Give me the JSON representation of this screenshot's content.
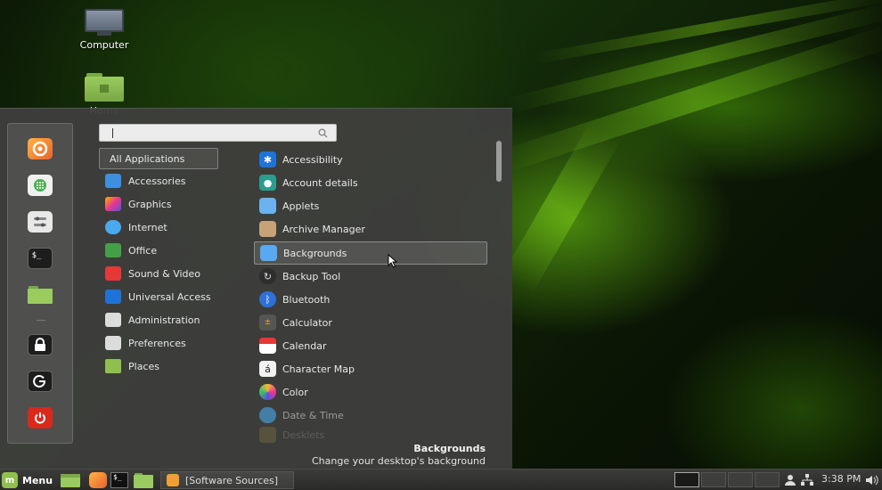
{
  "desktop": {
    "icons": [
      {
        "label": "Computer"
      },
      {
        "label": "Home"
      }
    ]
  },
  "menu": {
    "search": {
      "placeholder": "",
      "value": ""
    },
    "favorites": [
      {
        "icon": "firefox-icon"
      },
      {
        "icon": "software-manager-icon"
      },
      {
        "icon": "system-settings-icon"
      },
      {
        "icon": "terminal-icon"
      },
      {
        "icon": "files-folder-icon"
      },
      {
        "icon": "lock-screen-icon"
      },
      {
        "icon": "logout-icon"
      },
      {
        "icon": "shutdown-icon"
      }
    ],
    "categories": [
      {
        "label": "All Applications",
        "icon": "",
        "color": ""
      },
      {
        "label": "Accessories",
        "icon": "accessories-icon",
        "color": "#3d8fe0"
      },
      {
        "label": "Graphics",
        "icon": "graphics-icon",
        "color": "#c83fd0"
      },
      {
        "label": "Internet",
        "icon": "internet-icon",
        "color": "#4aa8ef"
      },
      {
        "label": "Office",
        "icon": "office-icon",
        "color": "#43a047"
      },
      {
        "label": "Sound & Video",
        "icon": "sound-video-icon",
        "color": "#e53935"
      },
      {
        "label": "Universal Access",
        "icon": "universal-access-icon",
        "color": "#1e73d8"
      },
      {
        "label": "Administration",
        "icon": "administration-icon",
        "color": "#dcdcdc"
      },
      {
        "label": "Preferences",
        "icon": "preferences-icon",
        "color": "#dcdcdc"
      },
      {
        "label": "Places",
        "icon": "places-icon",
        "color": "#8fc04e"
      }
    ],
    "apps": [
      {
        "label": "Accessibility",
        "icon": "accessibility-icon",
        "color": "#1e73d8"
      },
      {
        "label": "Account details",
        "icon": "account-details-icon",
        "color": "#2a9d8f"
      },
      {
        "label": "Applets",
        "icon": "applets-icon",
        "color": "#6bb3f0"
      },
      {
        "label": "Archive Manager",
        "icon": "archive-manager-icon",
        "color": "#c8a277"
      },
      {
        "label": "Backgrounds",
        "icon": "backgrounds-icon",
        "color": "#5aa8f0"
      },
      {
        "label": "Backup Tool",
        "icon": "backup-tool-icon",
        "color": "#2e2e2e"
      },
      {
        "label": "Bluetooth",
        "icon": "bluetooth-icon",
        "color": "#2f6fd6"
      },
      {
        "label": "Calculator",
        "icon": "calculator-icon",
        "color": "#555555"
      },
      {
        "label": "Calendar",
        "icon": "calendar-icon",
        "color": "#e53935"
      },
      {
        "label": "Character Map",
        "icon": "character-map-icon",
        "color": "#f2f2f2"
      },
      {
        "label": "Color",
        "icon": "color-icon",
        "color": "#f3b73a"
      },
      {
        "label": "Date & Time",
        "icon": "date-time-icon",
        "color": "#4aa8ef"
      },
      {
        "label": "Desklets",
        "icon": "desklets-icon",
        "color": "#8a7a40"
      }
    ],
    "selected_description": {
      "title": "Backgrounds",
      "body": "Change your desktop's background"
    }
  },
  "panel": {
    "menu_label": "Menu",
    "task_label": "[Software Sources]",
    "workspaces": 4,
    "active_workspace": 1,
    "clock": "3:38 PM"
  },
  "colors": {
    "menu_bg": "#3e3e3c",
    "accent": "#8fc04e",
    "wallpaper_green": "#78dc14"
  }
}
